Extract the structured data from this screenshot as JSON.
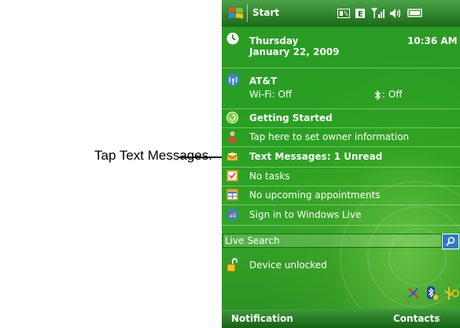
{
  "callout": {
    "text": "Tap Text Messages."
  },
  "topbar": {
    "start_label": "Start"
  },
  "clock": {
    "day": "Thursday",
    "date": "January 22, 2009",
    "time": "10:36 AM"
  },
  "carrier": {
    "name": "AT&T",
    "wifi": "Wi-Fi: Off",
    "bluetooth": ": Off"
  },
  "items": {
    "getting_started": "Getting Started",
    "owner": "Tap here to set owner information",
    "messages": "Text Messages: 1 Unread",
    "tasks": "No tasks",
    "appointments": "No upcoming appointments",
    "live": "Sign in to Windows Live",
    "lock": "Device unlocked"
  },
  "search": {
    "value": "Live Search"
  },
  "softkeys": {
    "left": "Notification",
    "right": "Contacts"
  },
  "colors": {
    "screen_green": "#28a021",
    "title_green": "#1b6a19"
  }
}
